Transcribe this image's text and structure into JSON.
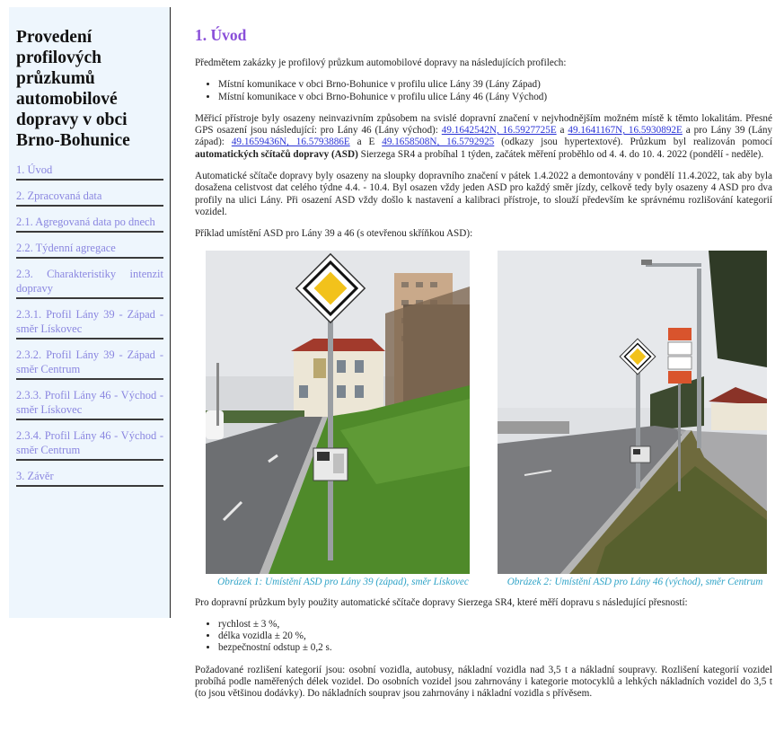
{
  "sidebar": {
    "title": "Provedení profilových průzkumů automobilové dopravy v obci Brno-Bohunice",
    "items": [
      {
        "label": "1. Úvod"
      },
      {
        "label": "2. Zpracovaná data"
      },
      {
        "label": "2.1. Agregovaná data po dnech"
      },
      {
        "label": "2.2. Týdenní agregace"
      },
      {
        "label": "2.3. Charakteristiky intenzit dopravy"
      },
      {
        "label": "2.3.1. Profil Lány 39 - Západ - směr Lískovec"
      },
      {
        "label": "2.3.2. Profil Lány 39 - Západ - směr Centrum"
      },
      {
        "label": "2.3.3. Profil Lány 46 - Východ - směr Lískovec"
      },
      {
        "label": "2.3.4. Profil Lány 46 - Východ - směr Centrum"
      },
      {
        "label": "3. Závěr"
      }
    ]
  },
  "main": {
    "heading": "1. Úvod",
    "intro": "Předmětem zakázky je profilový průzkum automobilové dopravy na následujících profilech:",
    "profiles": [
      "Místní komunikace v obci Brno-Bohunice v profilu ulice Lány 39 (Lány Západ)",
      "Místní komunikace v obci Brno-Bohunice v profilu ulice Lány 46 (Lány Východ)"
    ],
    "p2": {
      "t1": "Měřicí přístroje byly osazeny neinvazivním způsobem na svislé dopravní značení v nejvhodnějším možném místě k těmto lokalitám. Přesné GPS osazení jsou následující: pro Lány 46 (Lány východ): ",
      "link1": "49.1642542N, 16.5927725E",
      "t2": " a ",
      "link2": "49.1641167N, 16.5930892E",
      "t3": " a pro Lány 39 (Lány západ): ",
      "link3": "49.1659436N, 16.5793886E",
      "t4": " a E ",
      "link4": "49.1658508N, 16.5792925",
      "t5": " (odkazy jsou hypertextové). Průzkum byl realizován pomocí ",
      "bold": "automatických sčítačů dopravy (ASD)",
      "t6": " Sierzega SR4 a probíhal 1 týden, začátek měření proběhlo od 4. 4. do 10. 4. 2022 (pondělí - neděle)."
    },
    "p3": "Automatické sčítače dopravy byly osazeny na sloupky dopravního značení v pátek 1.4.2022 a demontovány v pondělí 11.4.2022, tak aby byla dosažena celistvost dat celého týdne 4.4. - 10.4. Byl osazen vždy jeden ASD pro každý směr jízdy, celkově tedy byly osazeny 4 ASD pro dva profily na ulici Lány. Při osazení ASD vždy došlo k nastavení a kalibraci přístroje, to slouží především ke správnému rozlišování kategorií vozidel.",
    "p4": "Příklad umístění ASD pro Lány 39 a 46 (s otevřenou skříňkou ASD):",
    "figures": [
      {
        "caption": "Obrázek 1: Umístění ASD pro Lány 39 (západ), směr Lískovec"
      },
      {
        "caption": "Obrázek 2: Umístění ASD pro Lány 46 (východ), směr Centrum"
      }
    ],
    "p5": "Pro dopravní průzkum byly použity automatické sčítače dopravy Sierzega SR4, které měří dopravu s následující přesností:",
    "accuracy": [
      "rychlost ± 3 %,",
      "délka vozidla ± 20 %,",
      "bezpečnostní odstup ± 0,2 s."
    ],
    "p6": "Požadované rozlišení kategorií jsou: osobní vozidla, autobusy, nákladní vozidla nad 3,5 t a nákladní soupravy. Rozlišení kategorií vozidel probíhá podle naměřených délek vozidel. Do osobních vozidel jsou zahrnovány i kategorie motocyklů a lehkých nákladních vozidel do 3,5 t (to jsou většinou dodávky). Do nákladních souprav jsou zahrnovány i nákladní vozidla s přívěsem."
  },
  "colors": {
    "heading": "#8a4fd9",
    "toc_link": "#8a86e0",
    "caption": "#2fa3c7",
    "sidebar_bg": "#eef6fd",
    "hyperlink": "#2b34d6"
  }
}
